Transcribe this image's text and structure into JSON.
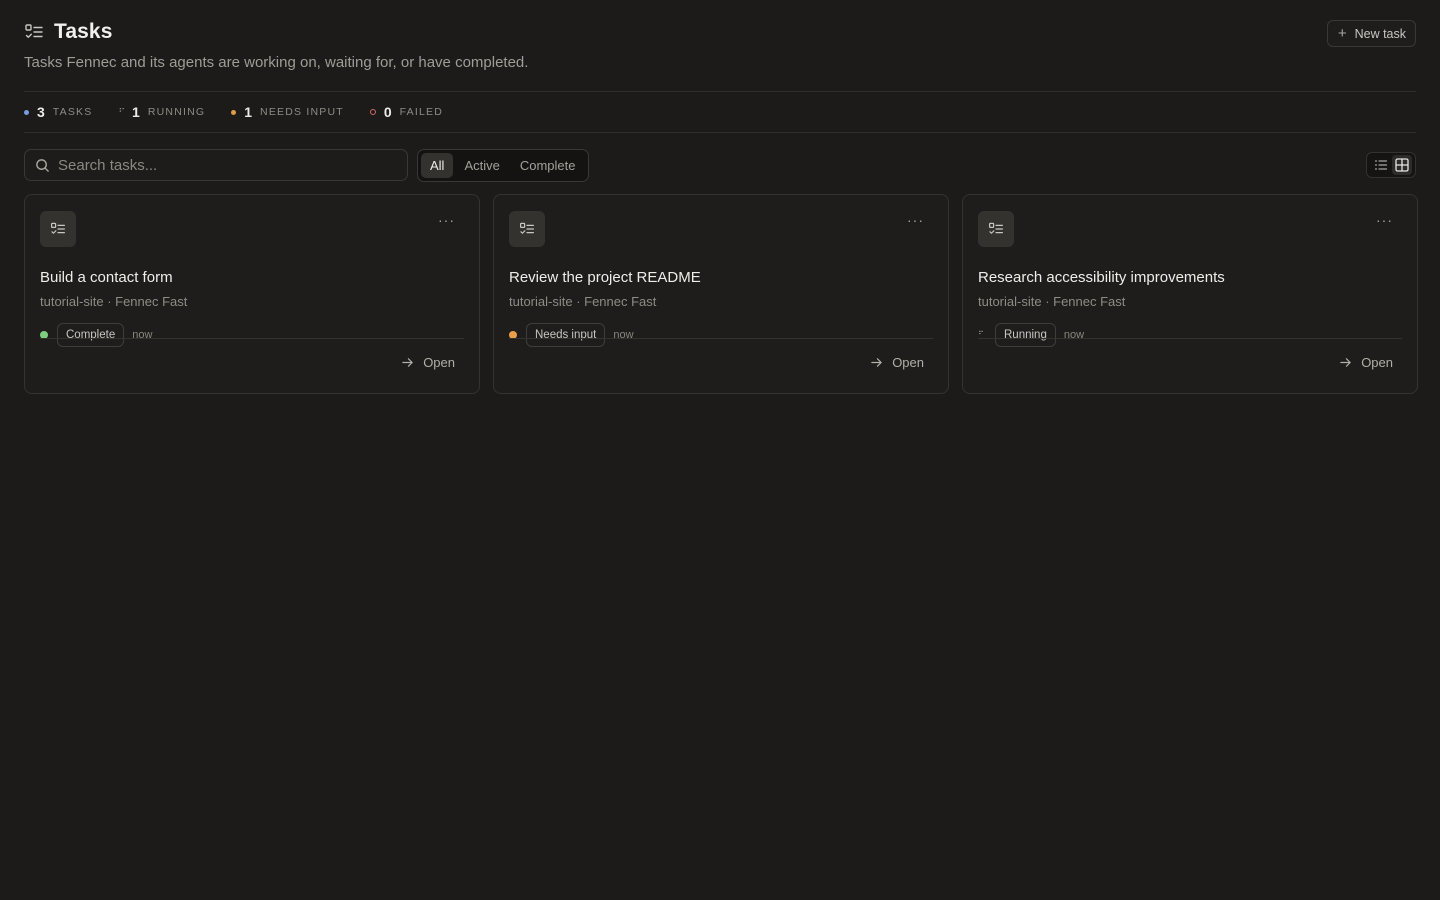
{
  "header": {
    "title": "Tasks",
    "subtitle": "Tasks Fennec and its agents are working on, waiting for, or have completed.",
    "new_task_label": "New task"
  },
  "stats": [
    {
      "count": "3",
      "label": "TASKS",
      "color": "#7b9be0",
      "indicator": "dot"
    },
    {
      "count": "1",
      "label": "RUNNING",
      "color": "#8f8b85",
      "indicator": "spinner"
    },
    {
      "count": "1",
      "label": "NEEDS INPUT",
      "color": "#e09a4a",
      "indicator": "dot"
    },
    {
      "count": "0",
      "label": "FAILED",
      "color": "#d06a6a",
      "indicator": "ring"
    }
  ],
  "search": {
    "placeholder": "Search tasks..."
  },
  "filters": {
    "tabs": [
      "All",
      "Active",
      "Complete"
    ],
    "selected": "All"
  },
  "view_toggle": {
    "options": [
      "list-view-icon",
      "grid-view-icon"
    ],
    "selected": "grid"
  },
  "tasks": [
    {
      "title": "Build a contact form",
      "project": "tutorial-site",
      "model": "Fennec Fast",
      "meta": "tutorial-site · Fennec Fast",
      "status": "Complete",
      "status_color": "#7fce7f",
      "status_indicator": "dot",
      "time": "now",
      "open_label": "Open"
    },
    {
      "title": "Review the project README",
      "project": "tutorial-site",
      "model": "Fennec Fast",
      "meta": "tutorial-site · Fennec Fast",
      "status": "Needs input",
      "status_color": "#e8a04a",
      "status_indicator": "dot",
      "time": "now",
      "open_label": "Open"
    },
    {
      "title": "Research accessibility improvements",
      "project": "tutorial-site",
      "model": "Fennec Fast",
      "meta": "tutorial-site · Fennec Fast",
      "status": "Running",
      "status_color": "#a09c96",
      "status_indicator": "spinner",
      "time": "now",
      "open_label": "Open"
    }
  ]
}
